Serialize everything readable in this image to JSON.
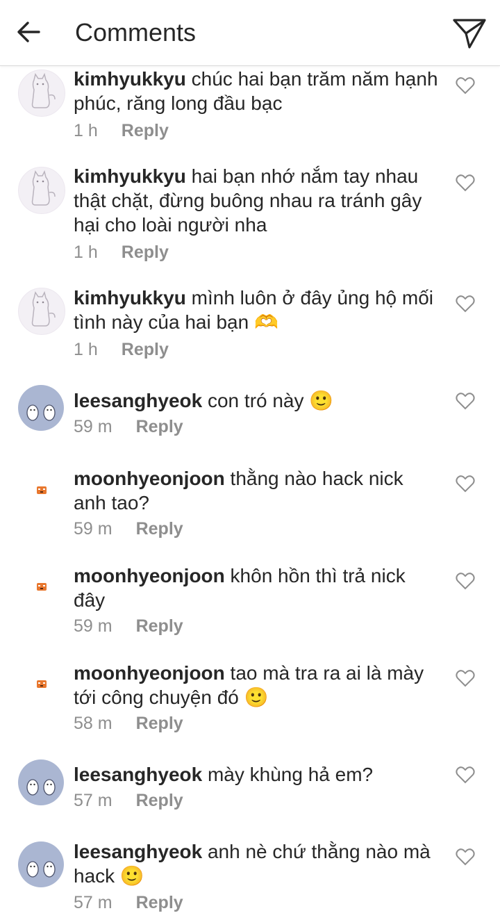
{
  "header": {
    "title": "Comments",
    "back_icon": "arrow-left-icon",
    "share_icon": "paper-plane-icon"
  },
  "comments": [
    {
      "user": "kimhyukkyu",
      "text": "chúc hai bạn trăm năm hạnh phúc, răng long đầu bạc",
      "time": "1 h",
      "reply": "Reply",
      "avatar": "alpaca"
    },
    {
      "user": "kimhyukkyu",
      "text": "hai bạn nhớ nắm tay nhau thật chặt, đừng buông nhau ra tránh gây hại cho loài người nha",
      "time": "1 h",
      "reply": "Reply",
      "avatar": "alpaca"
    },
    {
      "user": "kimhyukkyu",
      "text": "mình luôn ở đây ủng hộ mối tình này của hai bạn 🫶",
      "time": "1 h",
      "reply": "Reply",
      "avatar": "alpaca"
    },
    {
      "user": "leesanghyeok",
      "text": "con tró này 🙂",
      "time": "59 m",
      "reply": "Reply",
      "avatar": "penguin"
    },
    {
      "user": "moonhyeonjoon",
      "text": "thằng nào hack nick anh tao?",
      "time": "59 m",
      "reply": "Reply",
      "avatar": "tiger"
    },
    {
      "user": "moonhyeonjoon",
      "text": "khôn hồn thì trả nick đây",
      "time": "59 m",
      "reply": "Reply",
      "avatar": "tiger"
    },
    {
      "user": "moonhyeonjoon",
      "text": "tao mà tra ra ai là mày tới công chuyện đó 🙂",
      "time": "58 m",
      "reply": "Reply",
      "avatar": "tiger"
    },
    {
      "user": "leesanghyeok",
      "text": "mày khùng hả em?",
      "time": "57 m",
      "reply": "Reply",
      "avatar": "penguin"
    },
    {
      "user": "leesanghyeok",
      "text": "anh nè chứ thằng nào mà hack 🙂",
      "time": "57 m",
      "reply": "Reply",
      "avatar": "penguin"
    }
  ],
  "colors": {
    "text": "#262626",
    "meta": "#8e8e8e",
    "divider": "#dbdbdb"
  }
}
